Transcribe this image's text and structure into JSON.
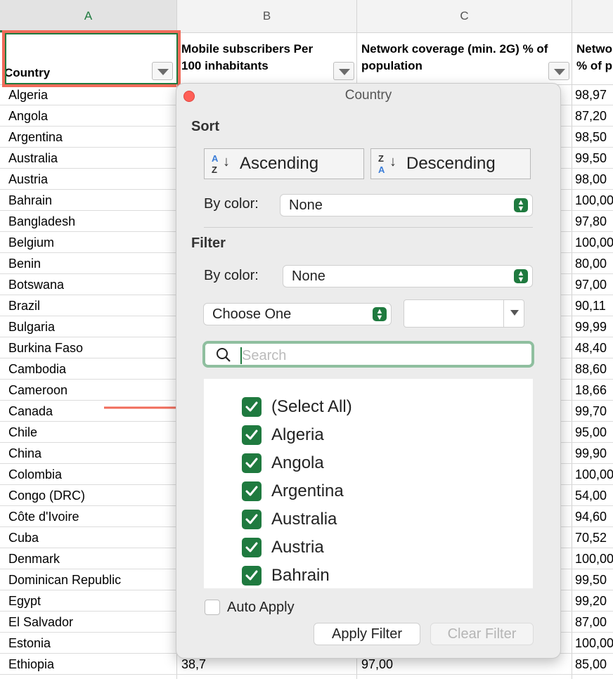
{
  "columns": {
    "a": "A",
    "b": "B",
    "c": "C"
  },
  "headers": {
    "country": "Country",
    "mobile_line1": "Mobile subscribers Per",
    "mobile_line2": "100 inhabitants",
    "coverage_line1": "Network coverage (min. 2G) % of",
    "coverage_line2": "population",
    "partial_line1": "Netwo",
    "partial_line2": "% of p"
  },
  "rows": [
    {
      "country": "Algeria",
      "d": "98,97"
    },
    {
      "country": "Angola",
      "d": "87,20"
    },
    {
      "country": "Argentina",
      "d": "98,50"
    },
    {
      "country": "Australia",
      "d": "99,50"
    },
    {
      "country": "Austria",
      "d": "98,00"
    },
    {
      "country": "Bahrain",
      "d": "100,00"
    },
    {
      "country": "Bangladesh",
      "d": "97,80"
    },
    {
      "country": "Belgium",
      "d": "100,00"
    },
    {
      "country": "Benin",
      "d": "80,00"
    },
    {
      "country": "Botswana",
      "d": "97,00"
    },
    {
      "country": "Brazil",
      "d": "90,11"
    },
    {
      "country": "Bulgaria",
      "d": "99,99"
    },
    {
      "country": "Burkina Faso",
      "d": "48,40"
    },
    {
      "country": "Cambodia",
      "d": "88,60"
    },
    {
      "country": "Cameroon",
      "d": "18,66"
    },
    {
      "country": "Canada",
      "d": "99,70"
    },
    {
      "country": "Chile",
      "d": "95,00"
    },
    {
      "country": "China",
      "d": "99,90"
    },
    {
      "country": "Colombia",
      "d": "100,00"
    },
    {
      "country": "Congo (DRC)",
      "d": "54,00"
    },
    {
      "country": "Côte d'Ivoire",
      "d": "94,60"
    },
    {
      "country": "Cuba",
      "d": "70,52"
    },
    {
      "country": "Denmark",
      "d": "100,00"
    },
    {
      "country": "Dominican Republic",
      "d": "99,50"
    },
    {
      "country": "Egypt",
      "d": "99,20"
    },
    {
      "country": "El Salvador",
      "d": "87,00"
    },
    {
      "country": "Estonia",
      "d": "100,00"
    },
    {
      "country": "Ethiopia",
      "b": "38,7",
      "c": "97,00",
      "d": "85,00"
    }
  ],
  "filter_panel": {
    "title": "Country",
    "sort_heading": "Sort",
    "ascending": "Ascending",
    "descending": "Descending",
    "sort_by_color_label": "By color:",
    "sort_by_color_value": "None",
    "filter_heading": "Filter",
    "filter_by_color_label": "By color:",
    "filter_by_color_value": "None",
    "choose_one": "Choose One",
    "search_placeholder": "Search",
    "items": [
      {
        "label": "(Select All)",
        "checked": true
      },
      {
        "label": "Algeria",
        "checked": true
      },
      {
        "label": "Angola",
        "checked": true
      },
      {
        "label": "Argentina",
        "checked": true
      },
      {
        "label": "Australia",
        "checked": true
      },
      {
        "label": "Austria",
        "checked": true
      },
      {
        "label": "Bahrain",
        "checked": true
      }
    ],
    "auto_apply": "Auto Apply",
    "apply_filter": "Apply Filter",
    "clear_filter": "Clear Filter"
  },
  "colors": {
    "accent_green": "#1f7a3f",
    "annotation_red": "#f06b5a",
    "close_red": "#ff5f57"
  }
}
